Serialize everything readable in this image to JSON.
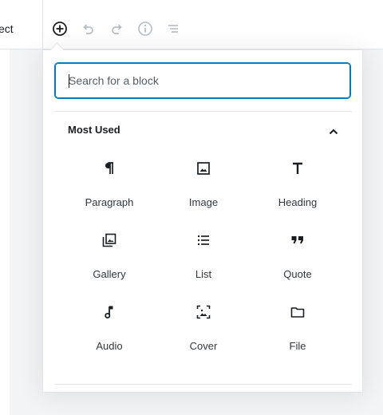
{
  "header": {
    "tab_stub_label": "ect",
    "toolbar": {
      "add_block": "plus-circle-icon",
      "undo": "undo-icon",
      "redo": "redo-icon",
      "info": "info-icon",
      "outline": "list-outline-icon"
    }
  },
  "inserter": {
    "search": {
      "placeholder": "Search for a block",
      "value": ""
    },
    "panel": {
      "title": "Most Used",
      "expanded": true
    },
    "blocks": [
      {
        "label": "Paragraph",
        "icon": "paragraph-icon"
      },
      {
        "label": "Image",
        "icon": "image-icon"
      },
      {
        "label": "Heading",
        "icon": "heading-icon"
      },
      {
        "label": "Gallery",
        "icon": "gallery-icon"
      },
      {
        "label": "List",
        "icon": "list-icon"
      },
      {
        "label": "Quote",
        "icon": "quote-icon"
      },
      {
        "label": "Audio",
        "icon": "audio-icon"
      },
      {
        "label": "Cover",
        "icon": "cover-icon"
      },
      {
        "label": "File",
        "icon": "file-icon"
      }
    ]
  },
  "colors": {
    "accent": "#007cba",
    "text": "#191e23",
    "muted_icon": "#b5bcc2",
    "border": "#e2e4e7"
  }
}
